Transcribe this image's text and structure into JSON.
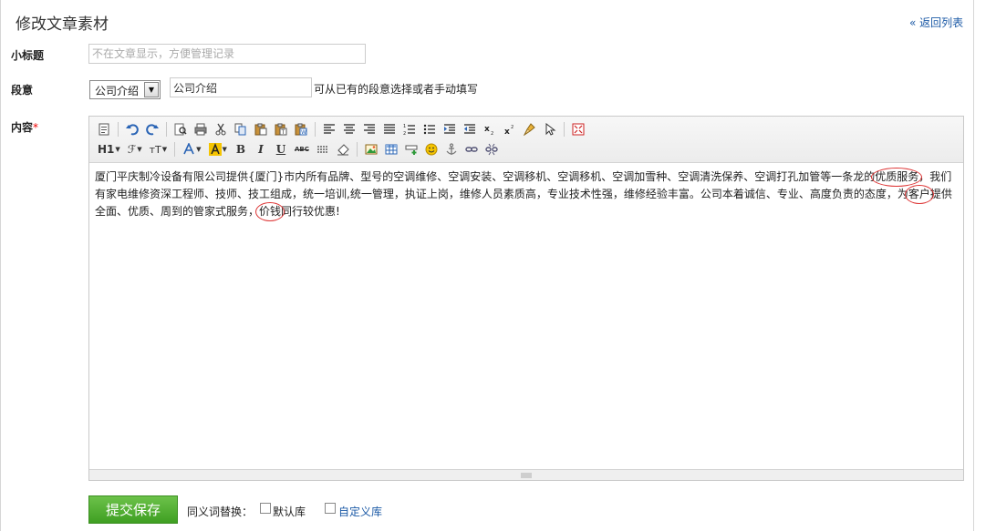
{
  "header": {
    "title": "修改文章素材",
    "back_link": "« 返回列表"
  },
  "form": {
    "subtitle": {
      "label": "小标题",
      "placeholder": "不在文章显示，方便管理记录",
      "value": ""
    },
    "paragraph": {
      "label": "段意",
      "selected_option": "公司介绍",
      "input_value": "公司介绍",
      "hint": "可从已有的段意选择或者手动填写"
    },
    "content": {
      "label": "内容",
      "required_mark": "*",
      "segments": [
        "厦门平庆制冷设备有限公司提供{厦门}市内所有品牌、型号的空调维修、空调安装、空调移机、空调移机、空调加雪种、空调清洗保养、空调打孔加管等一条龙的",
        "优质服务",
        "，我们有家电维修资深工程师、技师、技工组成，统一培训,统一管理，执证上岗，维修人员素质高，专业技术性强，维修经验丰富。公司本着诚信、专业、高度负责的态度，为",
        "客户",
        "提供全面、优质、周到的管家式服务，",
        "价钱",
        "同行较优惠!"
      ]
    }
  },
  "toolbar": {
    "heading_label": "H1",
    "font_family_label": "ℱ",
    "font_size_label": "тT",
    "bold_label": "B",
    "italic_label": "I",
    "underline_label": "U",
    "strike_label": "ABC"
  },
  "footer": {
    "submit_label": "提交保存",
    "synonym_label": "同义词替换：",
    "default_library": "默认库",
    "custom_library": "自定义库"
  },
  "colors": {
    "accent_green": "#4caf2e",
    "link_blue": "#1c5aa6",
    "circle_red": "#d33333"
  }
}
